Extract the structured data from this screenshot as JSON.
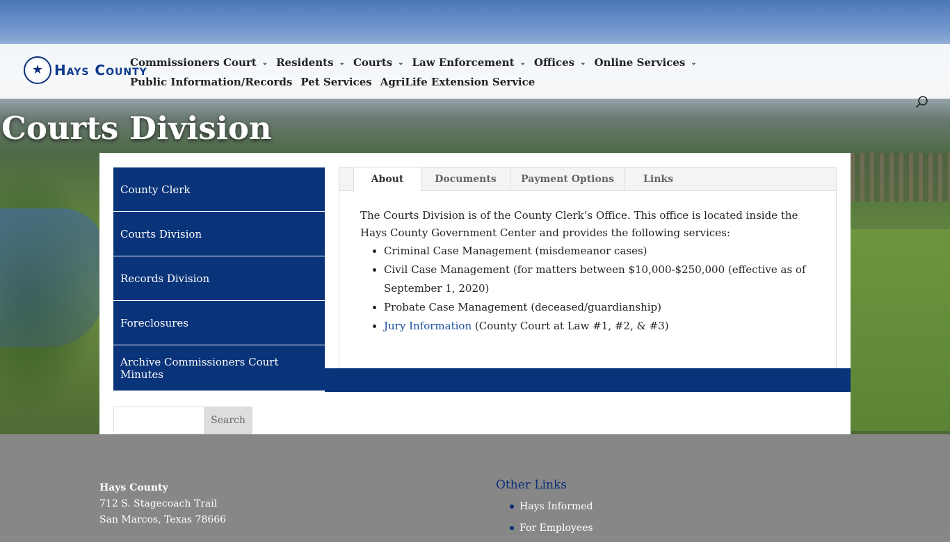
{
  "brand": {
    "logo_text": "Hays County",
    "accent_color": "#0a347a"
  },
  "nav": {
    "items": [
      {
        "label": "Commissioners Court",
        "has_dropdown": true
      },
      {
        "label": "Residents",
        "has_dropdown": true
      },
      {
        "label": "Courts",
        "has_dropdown": true
      },
      {
        "label": "Law Enforcement",
        "has_dropdown": true
      },
      {
        "label": "Offices",
        "has_dropdown": true
      },
      {
        "label": "Online Services",
        "has_dropdown": true
      },
      {
        "label": "Public Information/Records",
        "has_dropdown": false
      },
      {
        "label": "Pet Services",
        "has_dropdown": false
      },
      {
        "label": "AgriLife Extension Service",
        "has_dropdown": false
      }
    ],
    "search_icon": "search-icon"
  },
  "page": {
    "title": "Courts Division"
  },
  "sidebar": {
    "items": [
      {
        "label": "County Clerk"
      },
      {
        "label": "Courts Division"
      },
      {
        "label": "Records Division"
      },
      {
        "label": "Foreclosures"
      },
      {
        "label": "Archive Commissioners Court Minutes"
      }
    ]
  },
  "tabs": {
    "items": [
      {
        "label": "About",
        "active": true
      },
      {
        "label": "Documents",
        "active": false
      },
      {
        "label": "Payment Options",
        "active": false
      },
      {
        "label": "Links",
        "active": false
      }
    ],
    "about": {
      "intro": "The Courts Division is of the County Clerk’s Office. This office is located inside the Hays County Government Center and provides the following services:",
      "services": [
        "Criminal Case Management (misdemeanor cases)",
        "Civil Case Management (for matters between $10,000-$250,000 (effective as of September 1, 2020)",
        "Probate Case Management (deceased/guardianship)"
      ],
      "jury_link": "Jury Information",
      "jury_rest": " (County Court at Law #1, #2, & #3)"
    }
  },
  "search": {
    "placeholder": "",
    "button_label": "Search"
  },
  "footer": {
    "org": "Hays County",
    "address_line1": "712 S. Stagecoach Trail",
    "address_line2": "San Marcos, Texas 78666",
    "other_links_title": "Other Links",
    "other_links": [
      {
        "label": "Hays Informed"
      },
      {
        "label": "For Employees"
      }
    ]
  }
}
